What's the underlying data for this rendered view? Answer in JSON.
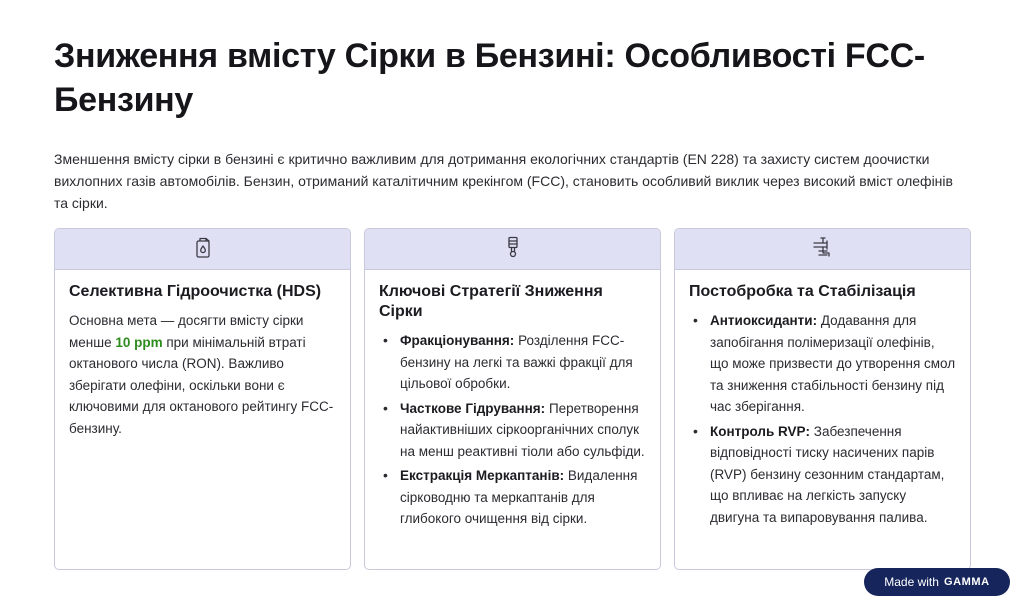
{
  "title": "Зниження вмісту Сірки в Бензині: Особливості FCC-Бензину",
  "intro": "Зменшення вмісту сірки в бензині є критично важливим для дотримання екологічних стандартів (EN 228) та захисту систем доочистки вихлопних газів автомобілів. Бензин, отриманий каталітичним крекінгом (FCC), становить особливий виклик через високий вміст олефінів та сірки.",
  "cards": [
    {
      "icon": "fuel-can-icon",
      "title": "Селективна Гідроочистка (HDS)",
      "text_before": "Основна мета — досягти вмісту сірки менше ",
      "highlight": "10 ppm",
      "text_after": " при мінімальній втраті октанового числа (RON). Важливо зберігати олефіни, оскільки вони є ключовими для октанового рейтингу FCC-бензину."
    },
    {
      "icon": "distillation-column-icon",
      "title": "Ключові Стратегії Зниження Сірки",
      "items": [
        {
          "label": "Фракціонування:",
          "text": " Розділення FCC-бензину на легкі та важкі фракції для цільової обробки."
        },
        {
          "label": "Часткове Гідрування:",
          "text": " Перетворення найактивніших сіркоорганічних сполук на менш реактивні тіоли або сульфіди."
        },
        {
          "label": "Екстракція Меркаптанів:",
          "text": " Видалення сірководню та меркаптанів для глибокого очищення від сірки."
        }
      ]
    },
    {
      "icon": "pipeline-valve-icon",
      "title": "Постобробка та Стабілізація",
      "items": [
        {
          "label": "Антиоксиданти:",
          "text": " Додавання для запобігання полімеризації олефінів, що може призвести до утворення смол та зниження стабільності бензину під час зберігання."
        },
        {
          "label": "Контроль RVP:",
          "text": " Забезпечення відповідності тиску насичених парів (RVP) бензину сезонним стандартам, що впливає на легкість запуску двигуна та випаровування палива."
        }
      ]
    }
  ],
  "badge": {
    "prefix": "Made with",
    "brand": "GAMMA"
  },
  "colors": {
    "accent_green": "#2e8b1e",
    "card_header": "#dfe0f4",
    "badge_bg": "#16255c"
  }
}
